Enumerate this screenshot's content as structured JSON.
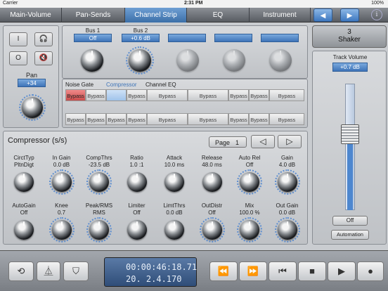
{
  "status": {
    "carrier": "Carrier",
    "time": "2:31 PM",
    "battery": "100%"
  },
  "nav": {
    "tabs": [
      "Main-Volume",
      "Pan-Sends",
      "Channel Strip",
      "EQ",
      "Instrument"
    ],
    "active": "Channel Strip",
    "prev_icon": "◀",
    "next_icon": "▶",
    "info_icon": "i"
  },
  "pan": {
    "label": "Pan",
    "value": "+34",
    "buttons": [
      "I",
      "headphones-icon",
      "O",
      "mute-icon"
    ]
  },
  "buses": [
    {
      "label": "Bus 1",
      "value": "Off"
    },
    {
      "label": "Bus 2",
      "value": "+0.6 dB"
    },
    {
      "label": "",
      "value": ""
    },
    {
      "label": "",
      "value": ""
    },
    {
      "label": "",
      "value": ""
    }
  ],
  "fx": {
    "labels": [
      "Noise Gate",
      "Compressor",
      "Channel EQ"
    ],
    "active": "Compressor",
    "row1": [
      "Bypass",
      "Bypass",
      "",
      "Bypass",
      "Bypass",
      "Bypass",
      "Bypass",
      "Bypass",
      "Bypass"
    ],
    "row2": [
      "Bypass",
      "Bypass",
      "Bypass",
      "Bypass",
      "Bypass",
      "Bypass",
      "Bypass",
      "Bypass",
      "Bypass"
    ]
  },
  "track": {
    "number": "3",
    "name": "Shaker",
    "volume_label": "Track Volume",
    "volume_value": "+0.7 dB",
    "volume_level": 0.6,
    "off_label": "Off",
    "automation_label": "Automation"
  },
  "compressor": {
    "title": "Compressor (s/s)",
    "page_label": "Page",
    "page_value": "1",
    "prev_icon": "◁",
    "next_icon": "▷",
    "row1": [
      {
        "name": "CirctTyp",
        "value": "PltnDigt"
      },
      {
        "name": "In Gain",
        "value": "0.0 dB"
      },
      {
        "name": "CompThrs",
        "value": "-23.5 dB"
      },
      {
        "name": "Ratio",
        "value": "1.0 :1"
      },
      {
        "name": "Attack",
        "value": "10.0 ms"
      },
      {
        "name": "Release",
        "value": "48.0 ms"
      },
      {
        "name": "Auto Rel",
        "value": "Off"
      },
      {
        "name": "Gain",
        "value": "4.0 dB"
      }
    ],
    "row2": [
      {
        "name": "AutoGain",
        "value": "Off"
      },
      {
        "name": "Knee",
        "value": "0.7"
      },
      {
        "name": "Peak/RMS",
        "value": "RMS"
      },
      {
        "name": "Limiter",
        "value": "Off"
      },
      {
        "name": "LimtThrs",
        "value": "0.0 dB"
      },
      {
        "name": "OutDistr",
        "value": "Off"
      },
      {
        "name": "Mix",
        "value": "100.0 %"
      },
      {
        "name": "Out Gain",
        "value": "0.0 dB"
      }
    ]
  },
  "transport": {
    "time": "00:00:46:18.71",
    "bars": "20. 2.4.170",
    "left_icons": [
      "cycle-icon",
      "metronome-icon",
      "replace-icon"
    ],
    "right_icons": [
      "⏪",
      "⏩",
      "⏮",
      "■",
      "▶",
      "●"
    ]
  },
  "colors": {
    "accent": "#3e74b8",
    "bypass_red": "#d85a5a"
  }
}
